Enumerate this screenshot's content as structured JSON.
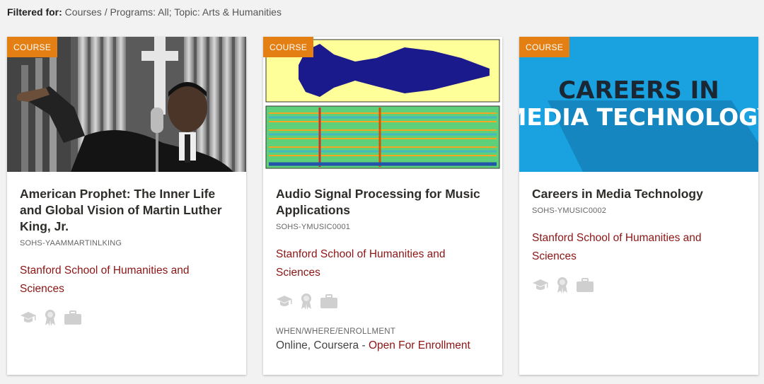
{
  "filter": {
    "label": "Filtered for:",
    "value": "Courses / Programs: All; Topic: Arts & Humanities"
  },
  "cards": [
    {
      "badge": "COURSE",
      "title": "American Prophet: The Inner Life and Global Vision of Martin Luther King, Jr.",
      "code": "SOHS-YAAMMARTINLKING",
      "school": "Stanford School of Humanities and Sciences",
      "icons": [
        "graduation-cap-icon",
        "ribbon-award-icon",
        "briefcase-icon"
      ]
    },
    {
      "badge": "COURSE",
      "title": "Audio Signal Processing for Music Applications",
      "code": "SOHS-YMUSIC0001",
      "school": "Stanford School of Humanities and Sciences",
      "icons": [
        "graduation-cap-icon",
        "ribbon-award-icon",
        "briefcase-icon"
      ],
      "when_label": "WHEN/WHERE/ENROLLMENT",
      "when_value": "Online, Coursera - ",
      "when_status": "Open For Enrollment"
    },
    {
      "badge": "COURSE",
      "title": "Careers in Media Technology",
      "code": "SOHS-YMUSIC0002",
      "school": "Stanford School of Humanities and Sciences",
      "icons": [
        "graduation-cap-icon",
        "ribbon-award-icon",
        "briefcase-icon"
      ],
      "image_text_line1": "CAREERS IN",
      "image_text_line2": "MEDIA TECHNOLOGY"
    }
  ],
  "colors": {
    "accent_orange": "#e47f14",
    "cardinal_red": "#8c1515",
    "media_blue": "#1aa1e0"
  }
}
